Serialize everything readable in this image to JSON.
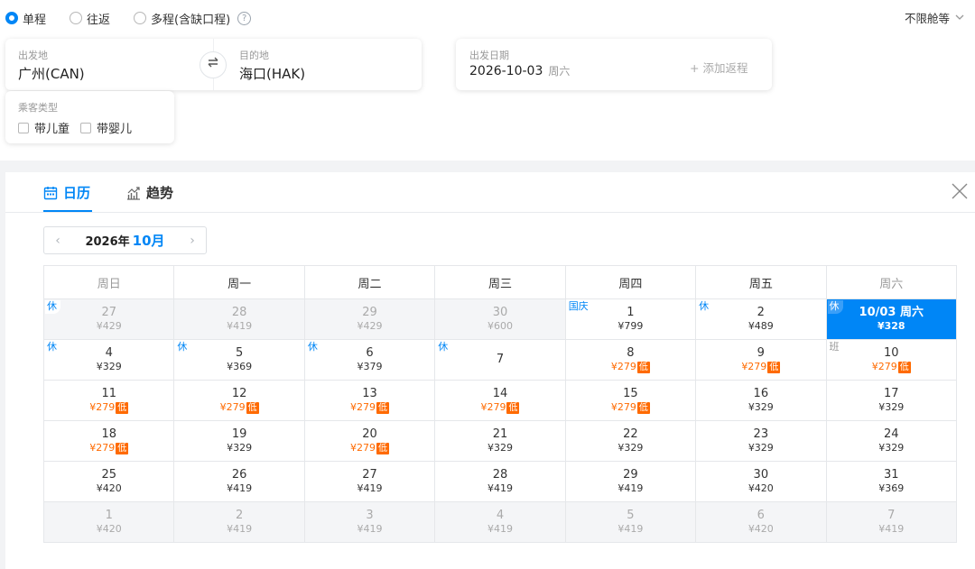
{
  "trip_types": [
    {
      "label": "单程",
      "selected": true
    },
    {
      "label": "往返",
      "selected": false
    },
    {
      "label": "多程(含缺口程)",
      "selected": false
    }
  ],
  "help_icon": "?",
  "cabin_select": {
    "label": "不限舱等",
    "icon": "chevron-down-icon"
  },
  "origin": {
    "label": "出发地",
    "value": "广州(CAN)"
  },
  "destination": {
    "label": "目的地",
    "value": "海口(HAK)"
  },
  "swap_icon": "⇄",
  "departure": {
    "label": "出发日期",
    "value": "2026-10-03",
    "weekday": "周六"
  },
  "add_return": "+ 添加返程",
  "passenger": {
    "label": "乘客类型",
    "options": [
      "带儿童",
      "带婴儿"
    ]
  },
  "tabs": [
    {
      "label": "日历",
      "icon": "calendar-icon",
      "active": true
    },
    {
      "label": "趋势",
      "icon": "trend-chart-icon",
      "active": false
    }
  ],
  "month_nav": {
    "year": "2026年",
    "month": "10月",
    "prev": "‹",
    "next": "›"
  },
  "weekdays": [
    "周日",
    "周一",
    "周二",
    "周三",
    "周四",
    "周五",
    "周六"
  ],
  "low_badge": "低",
  "colors": {
    "accent": "#0086f6",
    "low_price": "#ff6a00"
  },
  "calendar": [
    [
      {
        "day": "27",
        "price": "¥429",
        "out": true,
        "tag": "休"
      },
      {
        "day": "28",
        "price": "¥419",
        "out": true
      },
      {
        "day": "29",
        "price": "¥429",
        "out": true
      },
      {
        "day": "30",
        "price": "¥600",
        "out": true
      },
      {
        "day": "1",
        "price": "¥799",
        "tag": "国庆"
      },
      {
        "day": "2",
        "price": "¥489",
        "tag": "休"
      },
      {
        "day": "10/03 周六",
        "price": "¥328",
        "tag": "休",
        "selected": true
      }
    ],
    [
      {
        "day": "4",
        "price": "¥329",
        "tag": "休"
      },
      {
        "day": "5",
        "price": "¥369",
        "tag": "休"
      },
      {
        "day": "6",
        "price": "¥379",
        "tag": "休"
      },
      {
        "day": "7",
        "price": "",
        "tag": "休"
      },
      {
        "day": "8",
        "price": "¥279",
        "low": true
      },
      {
        "day": "9",
        "price": "¥279",
        "low": true
      },
      {
        "day": "10",
        "price": "¥279",
        "low": true,
        "tag": "班",
        "tag_type": "ban"
      }
    ],
    [
      {
        "day": "11",
        "price": "¥279",
        "low": true
      },
      {
        "day": "12",
        "price": "¥279",
        "low": true
      },
      {
        "day": "13",
        "price": "¥279",
        "low": true
      },
      {
        "day": "14",
        "price": "¥279",
        "low": true
      },
      {
        "day": "15",
        "price": "¥279",
        "low": true
      },
      {
        "day": "16",
        "price": "¥329"
      },
      {
        "day": "17",
        "price": "¥329"
      }
    ],
    [
      {
        "day": "18",
        "price": "¥279",
        "low": true
      },
      {
        "day": "19",
        "price": "¥329"
      },
      {
        "day": "20",
        "price": "¥279",
        "low": true
      },
      {
        "day": "21",
        "price": "¥329"
      },
      {
        "day": "22",
        "price": "¥329"
      },
      {
        "day": "23",
        "price": "¥329"
      },
      {
        "day": "24",
        "price": "¥329"
      }
    ],
    [
      {
        "day": "25",
        "price": "¥420"
      },
      {
        "day": "26",
        "price": "¥419"
      },
      {
        "day": "27",
        "price": "¥419"
      },
      {
        "day": "28",
        "price": "¥419"
      },
      {
        "day": "29",
        "price": "¥419"
      },
      {
        "day": "30",
        "price": "¥420"
      },
      {
        "day": "31",
        "price": "¥369"
      }
    ],
    [
      {
        "day": "1",
        "price": "¥420",
        "out": true
      },
      {
        "day": "2",
        "price": "¥419",
        "out": true
      },
      {
        "day": "3",
        "price": "¥419",
        "out": true
      },
      {
        "day": "4",
        "price": "¥419",
        "out": true
      },
      {
        "day": "5",
        "price": "¥419",
        "out": true
      },
      {
        "day": "6",
        "price": "¥420",
        "out": true
      },
      {
        "day": "7",
        "price": "¥419",
        "out": true
      }
    ]
  ]
}
